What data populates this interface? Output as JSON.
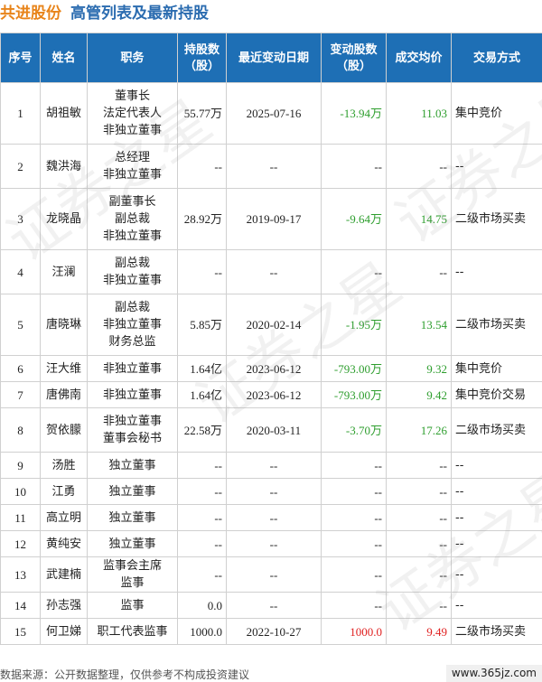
{
  "header": {
    "company": "共进股份",
    "subtitle": "高管列表及最新持股"
  },
  "table": {
    "columns": [
      "序号",
      "姓名",
      "职务",
      "持股数\n（股）",
      "最近变动日期",
      "变动股数\n（股）",
      "成交均价",
      "交易方式"
    ],
    "rows": [
      {
        "seq": "1",
        "name": "胡祖敏",
        "positions": [
          "董事长",
          "法定代表人",
          "非独立董事"
        ],
        "holding": "55.77万",
        "date": "2025-07-16",
        "change": "-13.94万",
        "change_sign": "neg",
        "price": "11.03",
        "price_sign": "neg",
        "mode": "集中竞价"
      },
      {
        "seq": "2",
        "name": "魏洪海",
        "positions": [
          "总经理",
          "非独立董事"
        ],
        "holding": "--",
        "date": "--",
        "change": "--",
        "change_sign": "",
        "price": "--",
        "price_sign": "",
        "mode": "--"
      },
      {
        "seq": "3",
        "name": "龙晓晶",
        "positions": [
          "副董事长",
          "副总裁",
          "非独立董事"
        ],
        "holding": "28.92万",
        "date": "2019-09-17",
        "change": "-9.64万",
        "change_sign": "neg",
        "price": "14.75",
        "price_sign": "neg",
        "mode": "二级市场买卖"
      },
      {
        "seq": "4",
        "name": "汪澜",
        "positions": [
          "副总裁",
          "非独立董事"
        ],
        "holding": "--",
        "date": "--",
        "change": "--",
        "change_sign": "",
        "price": "--",
        "price_sign": "",
        "mode": "--"
      },
      {
        "seq": "5",
        "name": "唐晓琳",
        "positions": [
          "副总裁",
          "非独立董事",
          "财务总监"
        ],
        "holding": "5.85万",
        "date": "2020-02-14",
        "change": "-1.95万",
        "change_sign": "neg",
        "price": "13.54",
        "price_sign": "neg",
        "mode": "二级市场买卖"
      },
      {
        "seq": "6",
        "name": "汪大维",
        "positions": [
          "非独立董事"
        ],
        "holding": "1.64亿",
        "date": "2023-06-12",
        "change": "-793.00万",
        "change_sign": "neg",
        "price": "9.32",
        "price_sign": "neg",
        "mode": "集中竞价"
      },
      {
        "seq": "7",
        "name": "唐佛南",
        "positions": [
          "非独立董事"
        ],
        "holding": "1.64亿",
        "date": "2023-06-12",
        "change": "-793.00万",
        "change_sign": "neg",
        "price": "9.42",
        "price_sign": "neg",
        "mode": "集中竞价交易"
      },
      {
        "seq": "8",
        "name": "贺依朦",
        "positions": [
          "非独立董事",
          "董事会秘书"
        ],
        "holding": "22.58万",
        "date": "2020-03-11",
        "change": "-3.70万",
        "change_sign": "neg",
        "price": "17.26",
        "price_sign": "neg",
        "mode": "二级市场买卖"
      },
      {
        "seq": "9",
        "name": "汤胜",
        "positions": [
          "独立董事"
        ],
        "holding": "--",
        "date": "--",
        "change": "--",
        "change_sign": "",
        "price": "--",
        "price_sign": "",
        "mode": "--"
      },
      {
        "seq": "10",
        "name": "江勇",
        "positions": [
          "独立董事"
        ],
        "holding": "--",
        "date": "--",
        "change": "--",
        "change_sign": "",
        "price": "--",
        "price_sign": "",
        "mode": "--"
      },
      {
        "seq": "11",
        "name": "高立明",
        "positions": [
          "独立董事"
        ],
        "holding": "--",
        "date": "--",
        "change": "--",
        "change_sign": "",
        "price": "--",
        "price_sign": "",
        "mode": "--"
      },
      {
        "seq": "12",
        "name": "黄纯安",
        "positions": [
          "独立董事"
        ],
        "holding": "--",
        "date": "--",
        "change": "--",
        "change_sign": "",
        "price": "--",
        "price_sign": "",
        "mode": "--"
      },
      {
        "seq": "13",
        "name": "武建楠",
        "positions": [
          "监事会主席",
          "监事"
        ],
        "holding": "--",
        "date": "--",
        "change": "--",
        "change_sign": "",
        "price": "--",
        "price_sign": "",
        "mode": "--"
      },
      {
        "seq": "14",
        "name": "孙志强",
        "positions": [
          "监事"
        ],
        "holding": "0.0",
        "date": "--",
        "change": "--",
        "change_sign": "",
        "price": "--",
        "price_sign": "",
        "mode": "--"
      },
      {
        "seq": "15",
        "name": "何卫娣",
        "positions": [
          "职工代表监事"
        ],
        "holding": "1000.0",
        "date": "2022-10-27",
        "change": "1000.0",
        "change_sign": "pos",
        "price": "9.49",
        "price_sign": "pos",
        "mode": "二级市场买卖"
      }
    ]
  },
  "watermark": {
    "text": "证券之星"
  },
  "footer": {
    "source": "数据来源：公开数据整理，仅供参考不构成投资建议",
    "site": "www.365jz.com"
  }
}
